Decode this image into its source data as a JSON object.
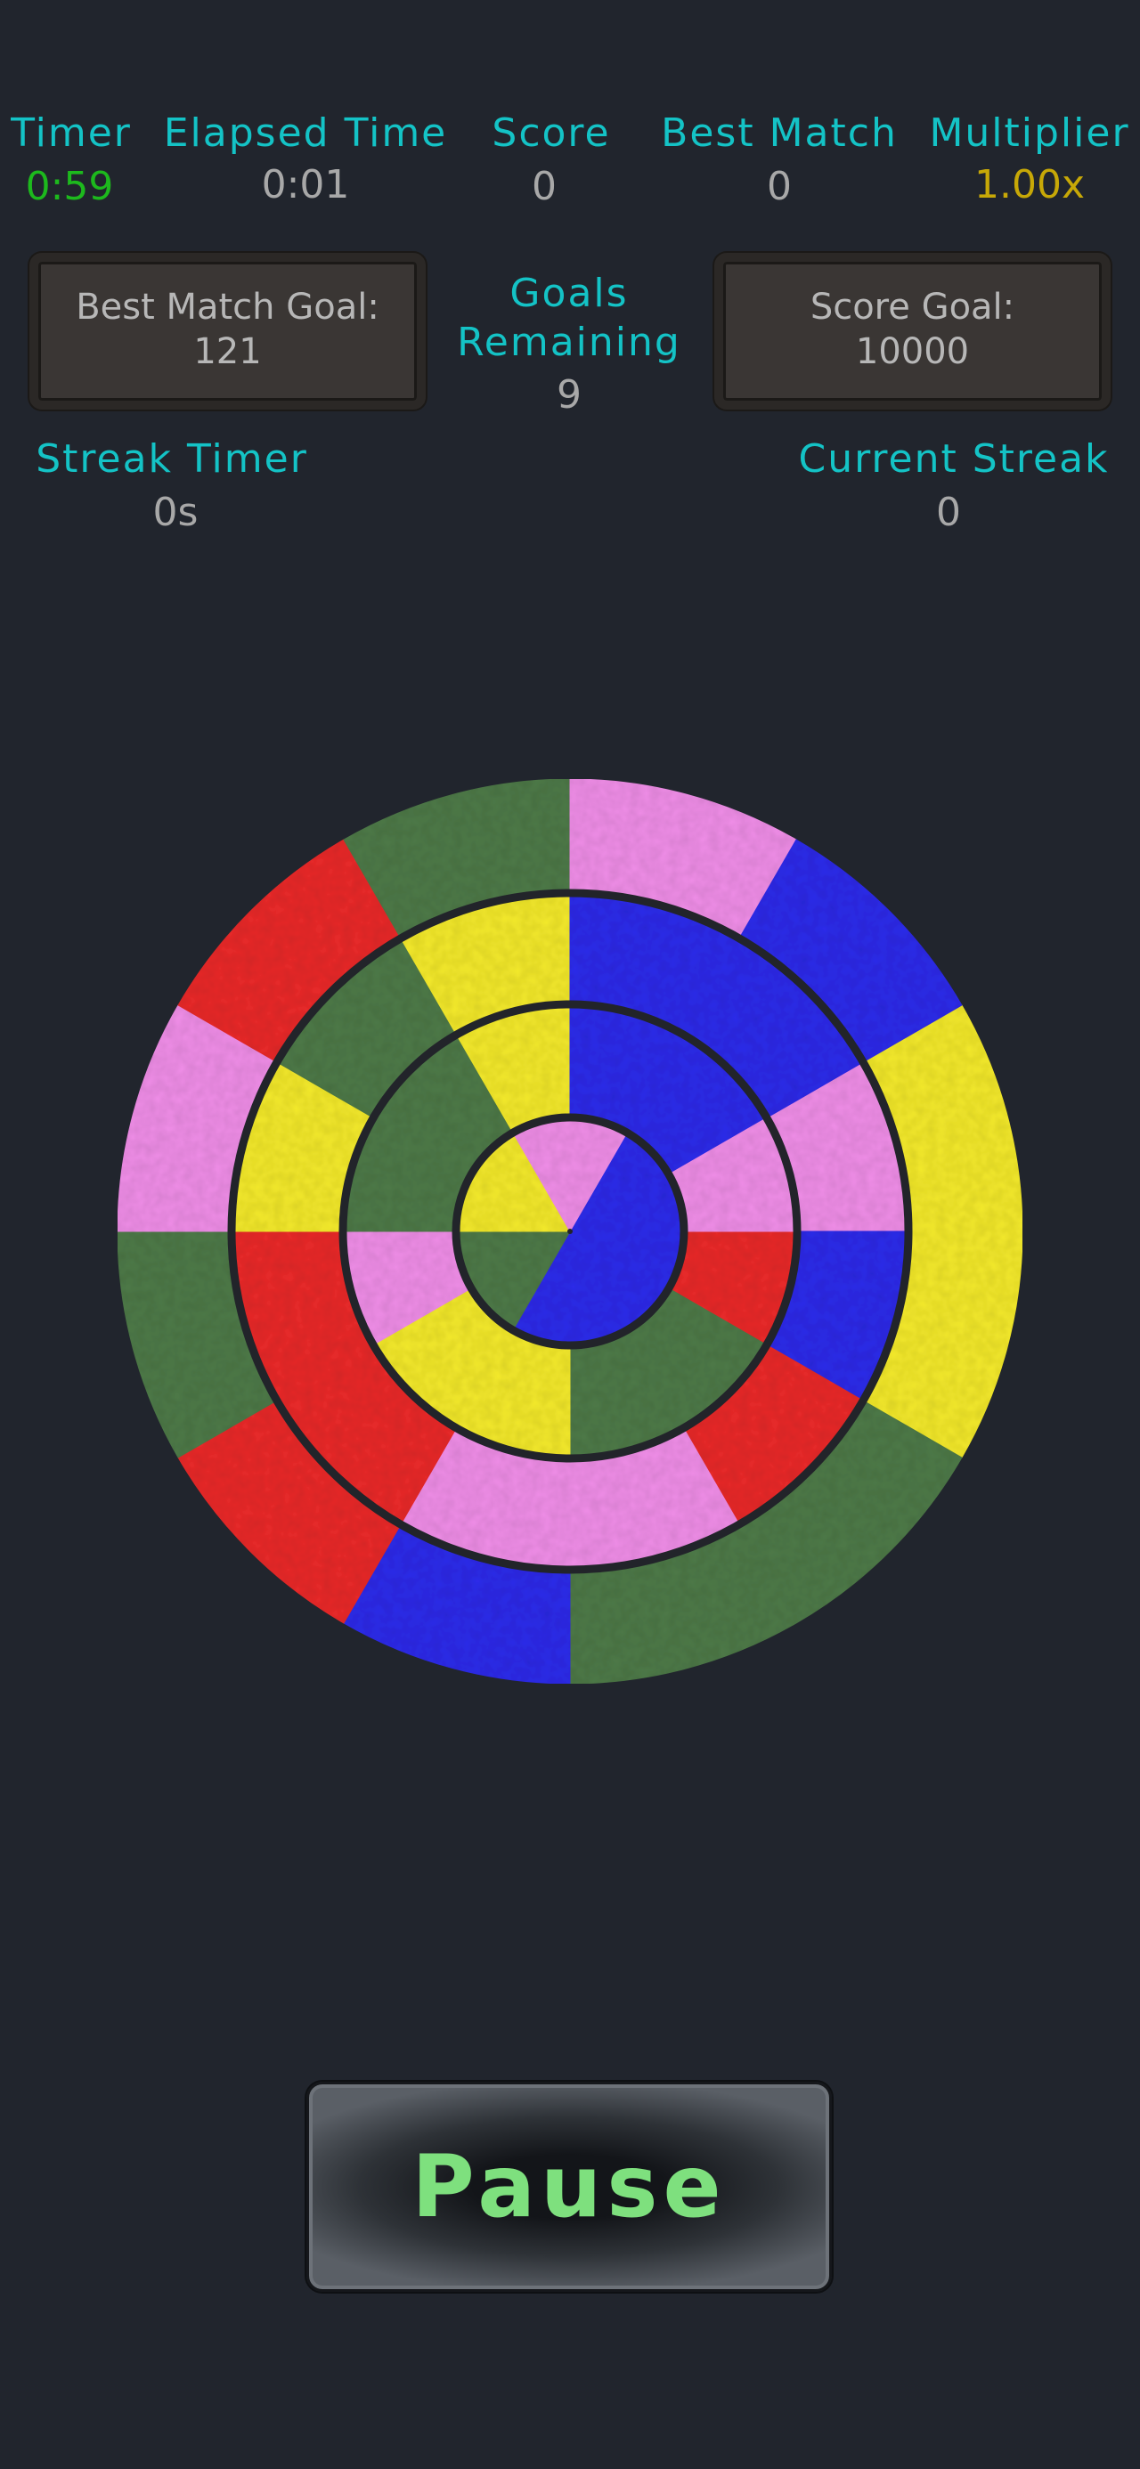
{
  "hud": {
    "timer": {
      "label": "Timer",
      "value": "0:59",
      "value_color": "#1db91d"
    },
    "elapsed": {
      "label": "Elapsed Time",
      "value": "0:01"
    },
    "score": {
      "label": "Score",
      "value": "0"
    },
    "best_match": {
      "label": "Best Match",
      "value": "0"
    },
    "multiplier": {
      "label": "Multiplier",
      "value": "1.00x",
      "value_color": "#c7a807"
    },
    "goals_remaining": {
      "label_line1": "Goals",
      "label_line2": "Remaining",
      "value": "9"
    },
    "streak_timer": {
      "label": "Streak Timer",
      "value": "0s"
    },
    "current_streak": {
      "label": "Current Streak",
      "value": "0"
    }
  },
  "goals": {
    "best_match_goal": {
      "label": "Best Match Goal:",
      "value": "121"
    },
    "score_goal": {
      "label": "Score Goal:",
      "value": "10000"
    }
  },
  "wheel": {
    "colors": {
      "yellow": "#f4ea2b",
      "green": "#4e7a48",
      "blue": "#2d2bea",
      "red": "#ea2a2a",
      "pink": "#f08ee8"
    },
    "rings": [
      {
        "name": "outer",
        "segments": [
          {
            "color": "yellow",
            "start": -30,
            "end": 30
          },
          {
            "color": "green",
            "start": 30,
            "end": 90
          },
          {
            "color": "blue",
            "start": 90,
            "end": 120
          },
          {
            "color": "red",
            "start": 120,
            "end": 150
          },
          {
            "color": "green",
            "start": 150,
            "end": 180
          },
          {
            "color": "pink",
            "start": 180,
            "end": 210
          },
          {
            "color": "red",
            "start": 210,
            "end": 240
          },
          {
            "color": "green",
            "start": 240,
            "end": 270
          },
          {
            "color": "pink",
            "start": 270,
            "end": 300
          },
          {
            "color": "blue",
            "start": 300,
            "end": 330
          }
        ]
      },
      {
        "name": "ring-2",
        "segments": [
          {
            "color": "pink",
            "start": -30,
            "end": 0
          },
          {
            "color": "blue",
            "start": 0,
            "end": 30
          },
          {
            "color": "red",
            "start": 30,
            "end": 60
          },
          {
            "color": "pink",
            "start": 60,
            "end": 120
          },
          {
            "color": "red",
            "start": 120,
            "end": 180
          },
          {
            "color": "yellow",
            "start": 180,
            "end": 210
          },
          {
            "color": "green",
            "start": 210,
            "end": 240
          },
          {
            "color": "yellow",
            "start": 240,
            "end": 270
          },
          {
            "color": "blue",
            "start": 270,
            "end": 330
          }
        ]
      },
      {
        "name": "ring-3",
        "segments": [
          {
            "color": "red",
            "start": 0,
            "end": 30
          },
          {
            "color": "green",
            "start": 30,
            "end": 90
          },
          {
            "color": "yellow",
            "start": 90,
            "end": 150
          },
          {
            "color": "pink",
            "start": 150,
            "end": 180
          },
          {
            "color": "green",
            "start": 180,
            "end": 240
          },
          {
            "color": "yellow",
            "start": 240,
            "end": 270
          },
          {
            "color": "blue",
            "start": 270,
            "end": 330
          },
          {
            "color": "pink",
            "start": 330,
            "end": 360
          }
        ]
      },
      {
        "name": "inner",
        "segments": [
          {
            "color": "blue",
            "start": -60,
            "end": 120
          },
          {
            "color": "green",
            "start": 120,
            "end": 180
          },
          {
            "color": "yellow",
            "start": 180,
            "end": 240
          },
          {
            "color": "pink",
            "start": 240,
            "end": 300
          }
        ]
      }
    ]
  },
  "pause_button": {
    "label": "Pause",
    "text_color": "#7ee07e"
  }
}
